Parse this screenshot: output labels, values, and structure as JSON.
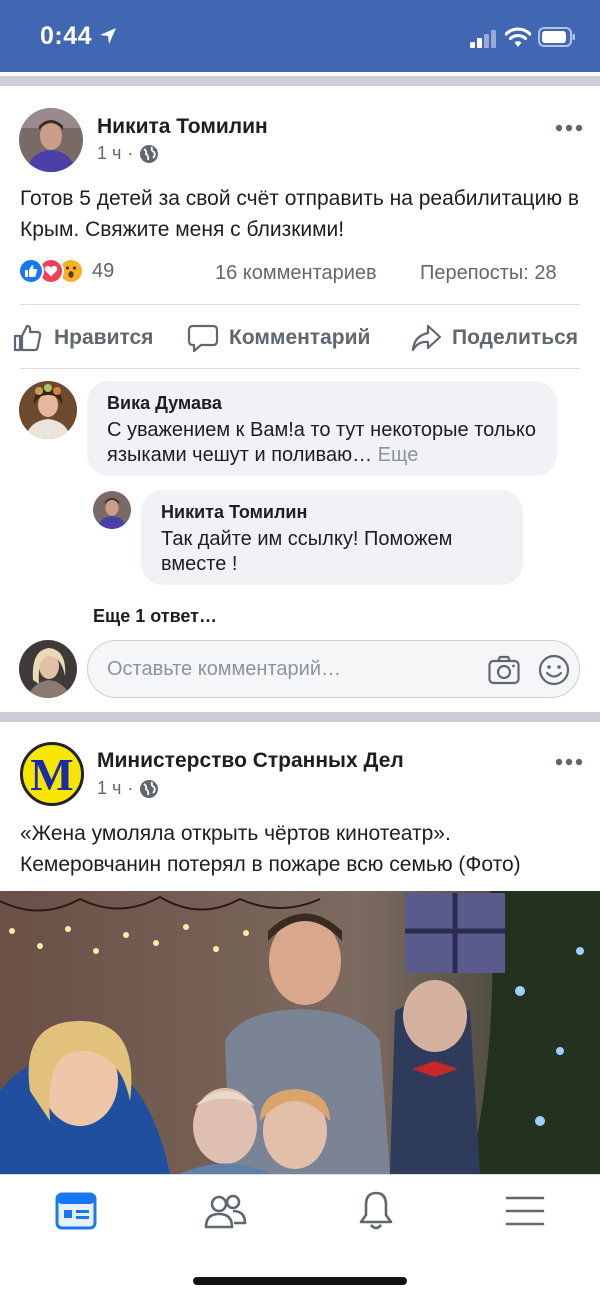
{
  "status_bar": {
    "time": "0:44",
    "icons": [
      "location-arrow-icon",
      "cellular-signal-icon",
      "wifi-icon",
      "battery-icon"
    ]
  },
  "colors": {
    "header_blue": "#4267b2",
    "like_blue": "#1877f2",
    "love_red": "#f33e58",
    "wow_yellow": "#f7b125",
    "text_secondary": "#606770"
  },
  "post1": {
    "author": "Никита Томилин",
    "time": "1 ч",
    "text": "Готов 5 детей за свой счёт отправить на реабилитацию в Крым. Свяжите меня с близкими!",
    "reactions_count": "49",
    "comments_count": "16 комментариев",
    "shares": "Перепосты: 28",
    "actions": {
      "like": "Нравится",
      "comment": "Комментарий",
      "share": "Поделиться"
    },
    "comments": [
      {
        "author": "Вика Думава",
        "text": "С уважением к Вам!а то тут некоторые только языками чешут и поливаю…",
        "more": "Еще"
      }
    ],
    "reply": {
      "author": "Никита Томилин",
      "text": "Так дайте им ссылку! Поможем вместе !"
    },
    "more_replies": "Еще 1 ответ…",
    "comment_placeholder": "Оставьте комментарий…"
  },
  "post2": {
    "logo_letter": "M",
    "author": "Министерство Странных Дел",
    "time": "1 ч",
    "text": "«Жена умоляла открыть чёртов кинотеатр». Кемеровчанин потерял в пожаре всю семью (Фото)"
  },
  "tab_bar": {
    "tabs": [
      "news-feed-icon",
      "friends-icon",
      "notifications-icon",
      "menu-icon"
    ],
    "active": "news-feed-icon"
  }
}
